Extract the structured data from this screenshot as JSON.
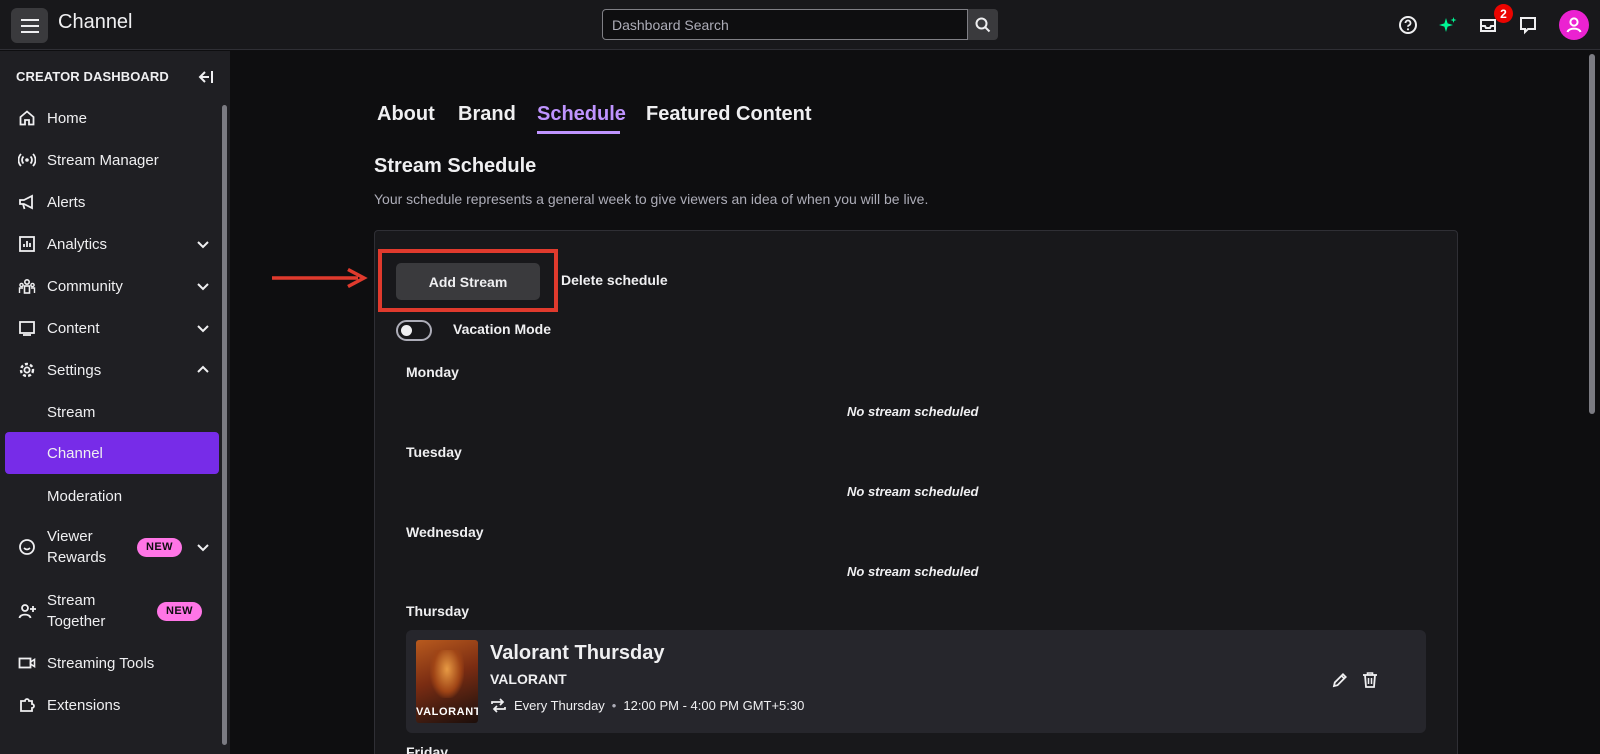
{
  "topbar": {
    "title": "Channel",
    "search_placeholder": "Dashboard Search",
    "notification_count": "2"
  },
  "sidebar": {
    "header": "CREATOR DASHBOARD",
    "items": [
      {
        "label": "Home",
        "icon": "home-icon"
      },
      {
        "label": "Stream Manager",
        "icon": "broadcast-icon"
      },
      {
        "label": "Alerts",
        "icon": "megaphone-icon"
      },
      {
        "label": "Analytics",
        "icon": "analytics-icon",
        "expandable": true
      },
      {
        "label": "Community",
        "icon": "community-icon",
        "expandable": true
      },
      {
        "label": "Content",
        "icon": "content-icon",
        "expandable": true
      },
      {
        "label": "Settings",
        "icon": "gear-icon",
        "expanded": true
      },
      {
        "label": "Stream"
      },
      {
        "label": "Channel",
        "active": true
      },
      {
        "label": "Moderation"
      },
      {
        "label": "Viewer Rewards",
        "icon": "smile-icon",
        "badge": "NEW"
      },
      {
        "label": "Stream Together",
        "icon": "add-person-icon",
        "badge": "NEW"
      },
      {
        "label": "Streaming Tools",
        "icon": "camera-icon"
      },
      {
        "label": "Extensions",
        "icon": "puzzle-icon"
      }
    ]
  },
  "tabs": [
    {
      "label": "About"
    },
    {
      "label": "Brand"
    },
    {
      "label": "Schedule",
      "active": true
    },
    {
      "label": "Featured Content"
    }
  ],
  "schedule": {
    "title": "Stream Schedule",
    "description": "Your schedule represents a general week to give viewers an idea of when you will be live.",
    "add_button": "Add Stream",
    "delete_link": "Delete schedule",
    "vacation_label": "Vacation Mode",
    "vacation_on": false,
    "empty_text": "No stream scheduled",
    "days": [
      "Monday",
      "Tuesday",
      "Wednesday",
      "Thursday",
      "Friday"
    ],
    "stream": {
      "title": "Valorant Thursday",
      "game": "VALORANT",
      "thumb_label": "VALORANT",
      "recurrence": "Every Thursday",
      "time": "12:00 PM - 4:00 PM GMT+5:30"
    }
  },
  "colors": {
    "accent": "#bf94ff",
    "active_nav": "#772ce8",
    "new_badge": "#ff75e6",
    "annotation": "#e03a2d",
    "notification_badge": "#eb0400",
    "avatar": "#eb22d1"
  }
}
